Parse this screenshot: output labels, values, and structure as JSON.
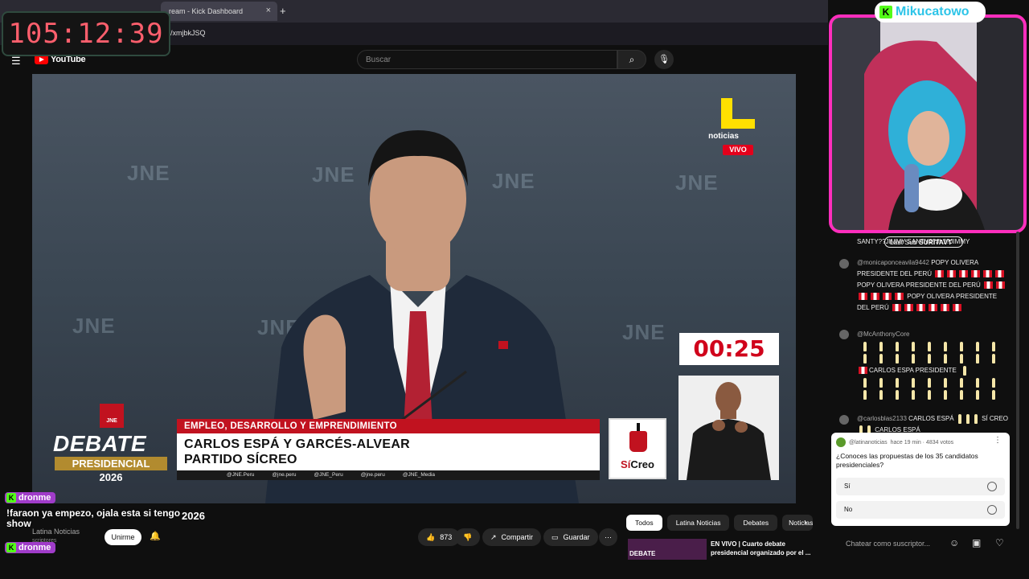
{
  "browser": {
    "tab_title": "ream - Kick Dashboard",
    "tab_close": "×",
    "new_tab": "+",
    "url": "/xmjbkJSQ"
  },
  "overlay": {
    "timer": "105:12:39",
    "chat_user": "dronme",
    "chat_text": "!faraon ya empezo, ojala esta si tengo show",
    "chat_user2": "dronme",
    "kick_glyph": "K"
  },
  "youtube": {
    "logo_text": "YouTube",
    "search_placeholder": "Buscar",
    "video_title_fragment": "2026",
    "channel": "Latina Noticias",
    "subs_fragment": "scriptores",
    "join_label": "Unirme",
    "likes": "873",
    "share": "Compartir",
    "save": "Guardar",
    "chips": [
      "Todos",
      "Latina Noticias",
      "Debates",
      "Noticias"
    ],
    "rec_thumb_label": "DEBATE",
    "rec_title": "EN VIVO | Cuarto debate presidencial organizado por el ..."
  },
  "video": {
    "watermark": "JNE",
    "channel_logo": "noticias",
    "live_badge": "VIVO",
    "countdown": "00:25",
    "topic": "EMPLEO, DESARROLLO Y EMPRENDIMIENTO",
    "name_line1": "CARLOS ESPÁ Y GARCÉS-ALVEAR",
    "name_line2": "PARTIDO SÍCREO",
    "socials": [
      "@JNE.Peru",
      "@jne.peru",
      "@JNE_Peru",
      "@jne.peru",
      "@JNE_Media"
    ],
    "party_a": "Sí",
    "party_b": "Creo",
    "debate_emblem": "JNE",
    "debate_l1": "DEBATE",
    "debate_l2": "PRESIDENCIAL",
    "debate_l3": "2026"
  },
  "stream": {
    "streamer": "Mikucatowo",
    "last_sub_label": "Last Sub",
    "last_sub_name": "SURITAVT"
  },
  "chat": {
    "m0": "SANTY??JIMMY SANTY??JI ??JIMMY",
    "m1_user": "@monicaponceavila9442",
    "m1_text": "POPY OLIVERA PRESIDENTE DEL PERÚ",
    "m1_text2": "POPY OLIVERA PRESIDENTE DEL PERÚ",
    "m1_text3": "POPY OLIVERA PRESIDENTE DEL PERÚ",
    "m2_user": "@McAnthonyCore",
    "m2_text": "CARLOS ESPA PRESIDENTE",
    "m3_user": "@carlosblas2133",
    "m3_text": "CARLOS ESPÁ",
    "m3_tail": "SÍ CREO",
    "m3_tail2": "CARLOS ESPÁ"
  },
  "poll": {
    "channel": "@latinanoticias",
    "meta": "hace 19 min · 4834 votos",
    "question": "¿Conoces las propuestas de los 35 candidatos presidenciales?",
    "opt1": "Sí",
    "opt2": "No"
  },
  "chat_input_placeholder": "Chatear como suscriptor..."
}
